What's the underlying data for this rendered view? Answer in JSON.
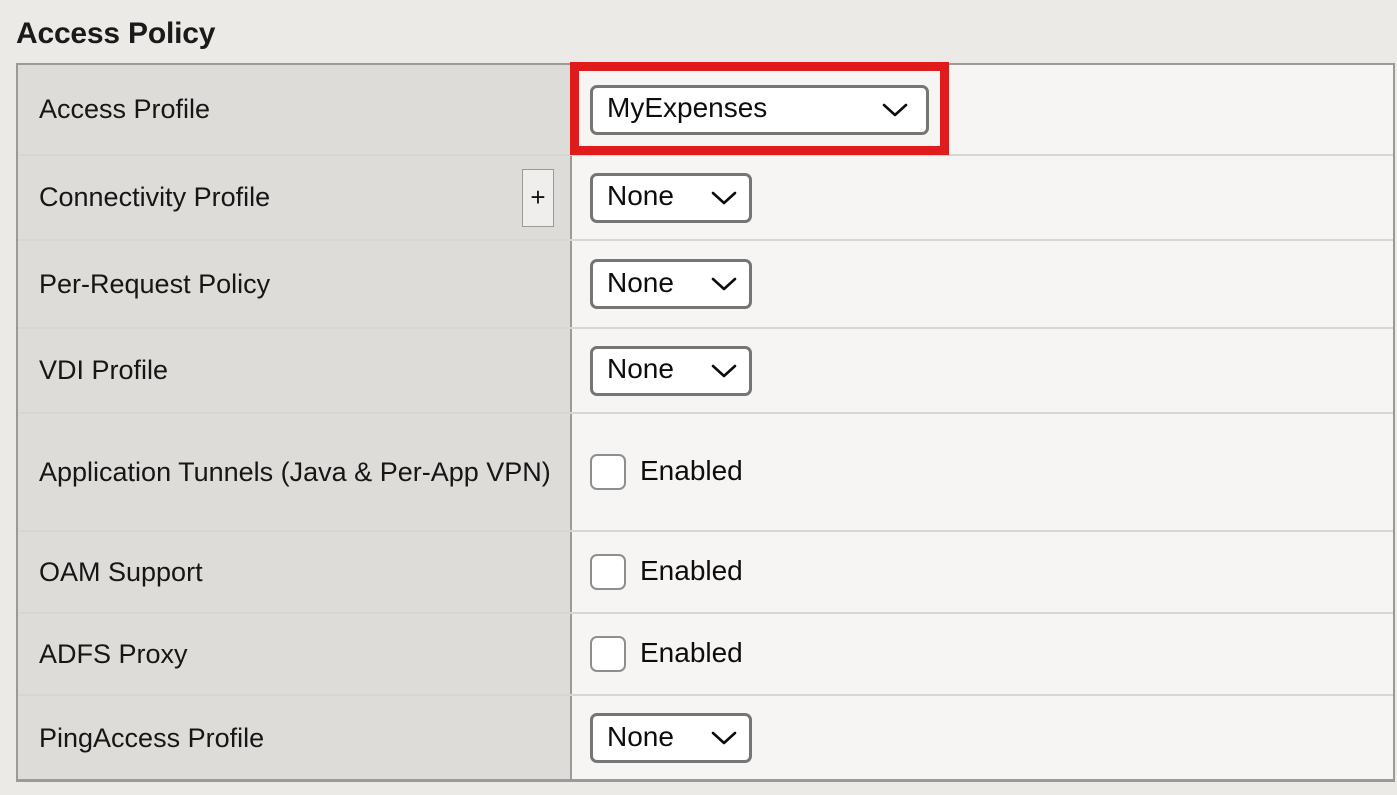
{
  "page": {
    "title": "Access Policy"
  },
  "highlight": {
    "color": "#e01b1b",
    "target": "access-profile-select"
  },
  "table": {
    "rows": [
      {
        "label": "Access Profile",
        "control": "select",
        "value": "MyExpenses",
        "has_plus": false,
        "highlighted": true
      },
      {
        "label": "Connectivity Profile",
        "control": "select",
        "value": "None",
        "has_plus": true,
        "plus_label": "+",
        "highlighted": false
      },
      {
        "label": "Per-Request Policy",
        "control": "select",
        "value": "None",
        "has_plus": false,
        "highlighted": false
      },
      {
        "label": "VDI Profile",
        "control": "select",
        "value": "None",
        "has_plus": false,
        "highlighted": false
      },
      {
        "label": "Application Tunnels (Java & Per-App VPN)",
        "control": "checkbox",
        "value": "Enabled",
        "checked": false,
        "has_plus": false,
        "highlighted": false
      },
      {
        "label": "OAM Support",
        "control": "checkbox",
        "value": "Enabled",
        "checked": false,
        "has_plus": false,
        "highlighted": false
      },
      {
        "label": "ADFS Proxy",
        "control": "checkbox",
        "value": "Enabled",
        "checked": false,
        "has_plus": false,
        "highlighted": false
      },
      {
        "label": "PingAccess Profile",
        "control": "select",
        "value": "None",
        "has_plus": false,
        "highlighted": false
      }
    ]
  },
  "icons": {
    "chevron_down": "chevron-down-icon",
    "plus": "plus-icon"
  }
}
